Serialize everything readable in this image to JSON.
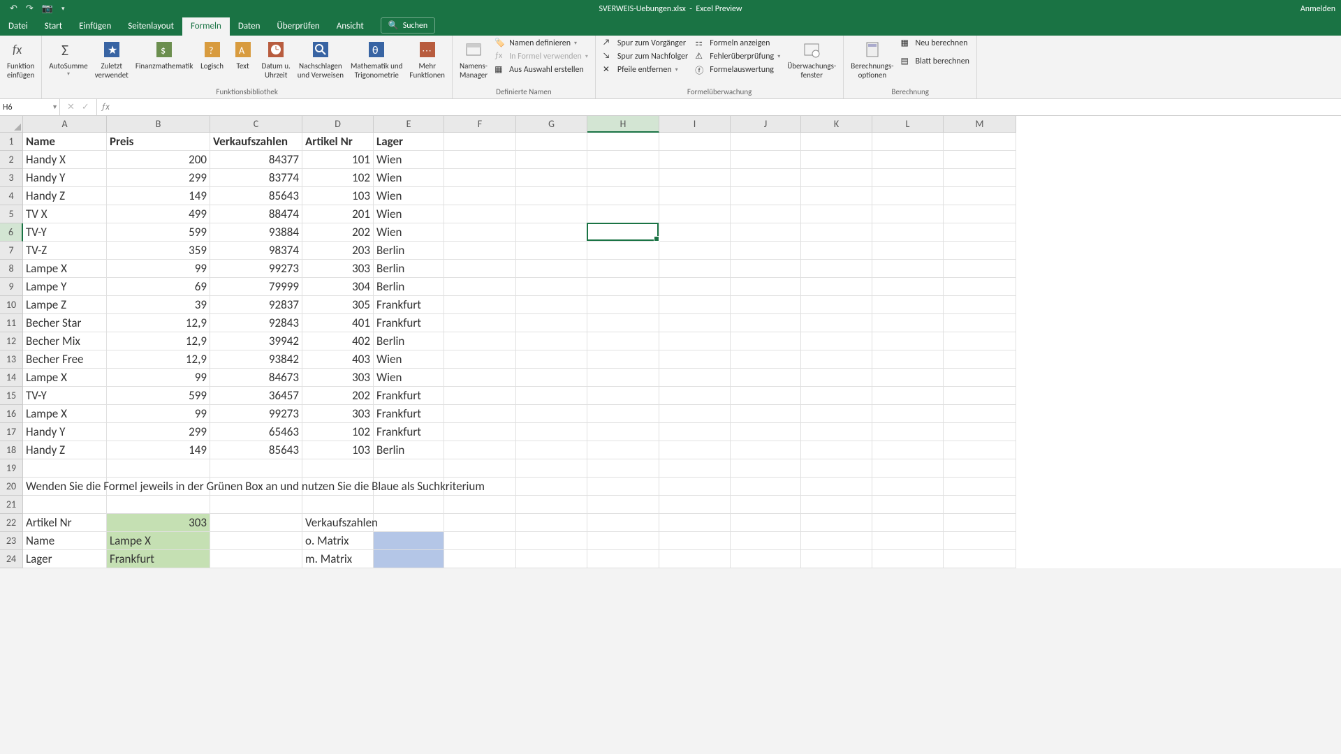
{
  "title": {
    "filename": "SVERWEIS-Uebungen.xlsx",
    "app": "Excel Preview",
    "signin": "Anmelden"
  },
  "qat": {
    "undo": "↶",
    "redo": "↷",
    "camera": "📷"
  },
  "tabs": {
    "file": "Datei",
    "start": "Start",
    "insert": "Einfügen",
    "pagelayout": "Seitenlayout",
    "formulas": "Formeln",
    "data": "Daten",
    "review": "Überprüfen",
    "view": "Ansicht",
    "search": "Suchen"
  },
  "ribbon": {
    "insert_function": "Funktion\neinfügen",
    "lib": {
      "autosum": "AutoSumme",
      "recent": "Zuletzt\nverwendet",
      "financial": "Finanzmathematik",
      "logical": "Logisch",
      "text": "Text",
      "date": "Datum u.\nUhrzeit",
      "lookup": "Nachschlagen\nund Verweisen",
      "math": "Mathematik und\nTrigonometrie",
      "more": "Mehr\nFunktionen",
      "group": "Funktionsbibliothek"
    },
    "names": {
      "manager": "Namens-\nManager",
      "define": "Namen definieren",
      "use": "In Formel verwenden",
      "create": "Aus Auswahl erstellen",
      "group": "Definierte Namen"
    },
    "audit": {
      "trace_prec": "Spur zum Vorgänger",
      "trace_dep": "Spur zum Nachfolger",
      "remove": "Pfeile entfernen",
      "show_f": "Formeln anzeigen",
      "error": "Fehlerüberprüfung",
      "eval": "Formelauswertung",
      "watch": "Überwachungs-\nfenster",
      "group": "Formelüberwachung"
    },
    "calc": {
      "options": "Berechnungs-\noptionen",
      "now": "Neu berechnen",
      "sheet": "Blatt berechnen",
      "group": "Berechnung"
    }
  },
  "namebox": "H6",
  "columns": [
    "A",
    "B",
    "C",
    "D",
    "E",
    "F",
    "G",
    "H",
    "I",
    "J",
    "K",
    "L",
    "M"
  ],
  "headers": {
    "A": "Name",
    "B": "Preis",
    "C": "Verkaufszahlen",
    "D": "Artikel Nr",
    "E": "Lager"
  },
  "data_rows": [
    {
      "A": "Handy X",
      "B": "200",
      "C": "84377",
      "D": "101",
      "E": "Wien"
    },
    {
      "A": "Handy Y",
      "B": "299",
      "C": "83774",
      "D": "102",
      "E": "Wien"
    },
    {
      "A": "Handy Z",
      "B": "149",
      "C": "85643",
      "D": "103",
      "E": "Wien"
    },
    {
      "A": "TV X",
      "B": "499",
      "C": "88474",
      "D": "201",
      "E": "Wien"
    },
    {
      "A": "TV-Y",
      "B": "599",
      "C": "93884",
      "D": "202",
      "E": "Wien"
    },
    {
      "A": "TV-Z",
      "B": "359",
      "C": "98374",
      "D": "203",
      "E": "Berlin"
    },
    {
      "A": "Lampe X",
      "B": "99",
      "C": "99273",
      "D": "303",
      "E": "Berlin"
    },
    {
      "A": "Lampe Y",
      "B": "69",
      "C": "79999",
      "D": "304",
      "E": "Berlin"
    },
    {
      "A": "Lampe Z",
      "B": "39",
      "C": "92837",
      "D": "305",
      "E": "Frankfurt"
    },
    {
      "A": "Becher Star",
      "B": "12,9",
      "C": "92843",
      "D": "401",
      "E": "Frankfurt"
    },
    {
      "A": "Becher Mix",
      "B": "12,9",
      "C": "39942",
      "D": "402",
      "E": "Berlin"
    },
    {
      "A": "Becher Free",
      "B": "12,9",
      "C": "93842",
      "D": "403",
      "E": "Wien"
    },
    {
      "A": "Lampe X",
      "B": "99",
      "C": "84673",
      "D": "303",
      "E": "Wien"
    },
    {
      "A": "TV-Y",
      "B": "599",
      "C": "36457",
      "D": "202",
      "E": "Frankfurt"
    },
    {
      "A": "Lampe X",
      "B": "99",
      "C": "99273",
      "D": "303",
      "E": "Frankfurt"
    },
    {
      "A": "Handy Y",
      "B": "299",
      "C": "65463",
      "D": "102",
      "E": "Frankfurt"
    },
    {
      "A": "Handy Z",
      "B": "149",
      "C": "85643",
      "D": "103",
      "E": "Berlin"
    }
  ],
  "row20": "Wenden Sie die Formel jeweils in der Grünen Box an und nutzen Sie die Blaue als Suchkriterium",
  "row22": {
    "A": "Artikel Nr",
    "B": "303",
    "D": "Verkaufszahlen"
  },
  "row23": {
    "A": "Name",
    "B": "Lampe X",
    "D": "o. Matrix"
  },
  "row24": {
    "A": "Lager",
    "B": "Frankfurt",
    "D": "m. Matrix"
  },
  "active_cell": "H6"
}
